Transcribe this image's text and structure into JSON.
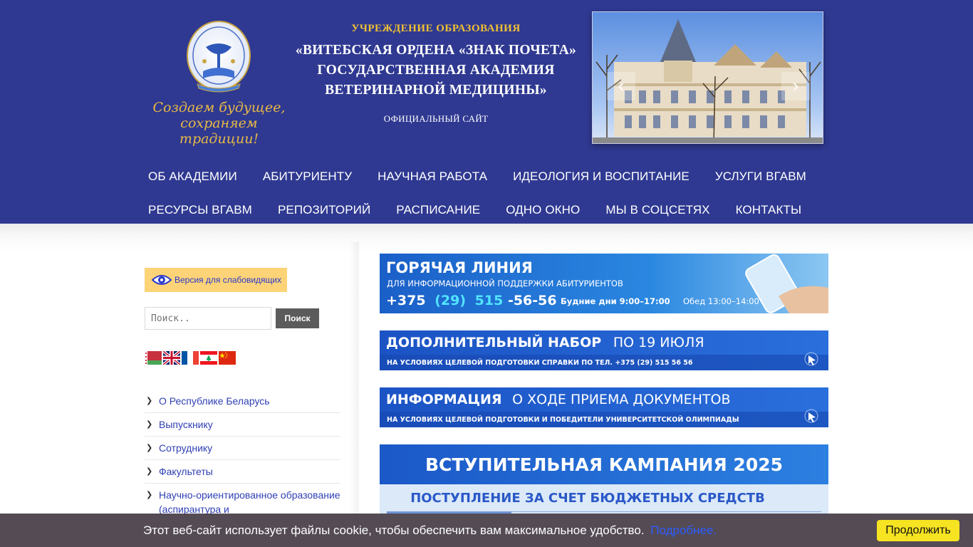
{
  "header": {
    "slogan_line1": "Создаем будущее,",
    "slogan_line2": "сохраняем традиции!",
    "title_small": "УЧРЕЖДЕНИЕ ОБРАЗОВАНИЯ",
    "title_line1": "«ВИТЕБСКАЯ ОРДЕНА «ЗНАК ПОЧЕТА»",
    "title_line2": "ГОСУДАРСТВЕННАЯ АКАДЕМИЯ",
    "title_line3": "ВЕТЕРИНАРНОЙ МЕДИЦИНЫ»",
    "official": "ОФИЦИАЛЬНЫЙ САЙТ",
    "slider_prev": "‹",
    "slider_next": "›"
  },
  "nav": {
    "row1": [
      "ОБ АКАДЕМИИ",
      "АБИТУРИЕНТУ",
      "НАУЧНАЯ РАБОТА",
      "ИДЕОЛОГИЯ И ВОСПИТАНИЕ",
      "УСЛУГИ ВГАВМ"
    ],
    "row2": [
      "РЕСУРСЫ ВГАВМ",
      "РЕПОЗИТОРИЙ",
      "РАСПИСАНИЕ",
      "ОДНО ОКНО",
      "МЫ В СОЦСЕТЯХ",
      "КОНТАКТЫ"
    ]
  },
  "sidebar": {
    "vision_label": "Версия для слабовидящих",
    "search_placeholder": "Поиск..",
    "search_button": "Поиск",
    "flags": [
      "belarus-flag",
      "uk-flag",
      "france-flag",
      "lebanon-flag",
      "china-flag"
    ],
    "menu": [
      {
        "label": "О Республике Беларусь"
      },
      {
        "label": "Выпускнику"
      },
      {
        "label": "Сотруднику"
      },
      {
        "label": "Факультеты"
      },
      {
        "label": "Научно-ориентированное образование (аспирантура и"
      }
    ]
  },
  "banners": {
    "hotline": {
      "title": "ГОРЯЧАЯ ЛИНИЯ",
      "subtitle": "ДЛЯ ИНФОРМАЦИОННОЙ ПОДДЕРЖКИ АБИТУРИЕНТОВ",
      "phone_prefix": "+375",
      "phone_code": "(29)",
      "phone_mid": "515",
      "phone_end": "-56-56",
      "hours": "Будние дни 9:00–17:00",
      "lunch": "Обед 13:00–14:00"
    },
    "additional": {
      "title_bold": "ДОПОЛНИТЕЛЬНЫЙ НАБОР",
      "title_rest": "ПО 19 ИЮЛЯ",
      "subtitle": "НА УСЛОВИЯХ ЦЕЛЕВОЙ ПОДГОТОВКИ СПРАВКИ ПО ТЕЛ. +375 (29) 515 56 56"
    },
    "info": {
      "title_bold": "ИНФОРМАЦИЯ",
      "title_rest": "О ХОДЕ ПРИЕМА ДОКУМЕНТОВ",
      "subtitle": "НА УСЛОВИЯХ ЦЕЛЕВОЙ ПОДГОТОВКИ И ПОБЕДИТЕЛИ УНИВЕРСИТЕТСКОЙ ОЛИМПИАДЫ"
    },
    "campaign": {
      "title": "ВСТУПИТЕЛЬНАЯ КАМПАНИЯ 2025",
      "subtitle": "ПОСТУПЛЕНИЕ ЗА СЧЕТ БЮДЖЕТНЫХ СРЕДСТВ"
    }
  },
  "cookie": {
    "text": "Этот веб-сайт использует файлы cookie, чтобы обеспечить вам максимальное удобство.",
    "link": "Подробнее.",
    "button": "Продолжить"
  },
  "colors": {
    "header_bg": "#2f3991",
    "gold": "#f2c232",
    "link_blue": "#2f3fb3",
    "banner_blue": "#1e63c9",
    "cookie_button": "#f6e321"
  }
}
